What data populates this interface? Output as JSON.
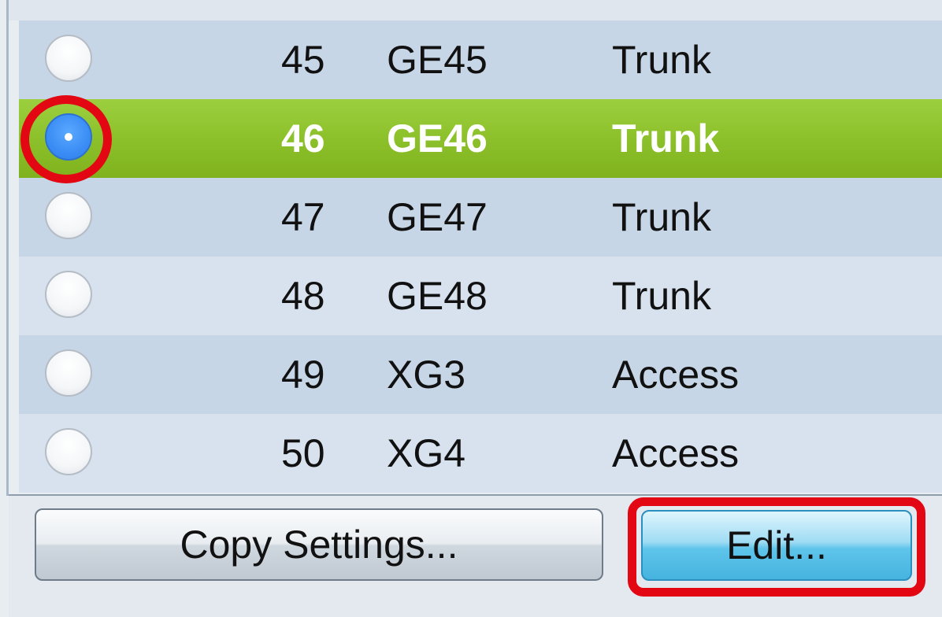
{
  "ports": [
    {
      "number": "45",
      "port": "GE45",
      "mode": "Trunk",
      "selected": false
    },
    {
      "number": "46",
      "port": "GE46",
      "mode": "Trunk",
      "selected": true
    },
    {
      "number": "47",
      "port": "GE47",
      "mode": "Trunk",
      "selected": false
    },
    {
      "number": "48",
      "port": "GE48",
      "mode": "Trunk",
      "selected": false
    },
    {
      "number": "49",
      "port": "XG3",
      "mode": "Access",
      "selected": false
    },
    {
      "number": "50",
      "port": "XG4",
      "mode": "Access",
      "selected": false
    }
  ],
  "buttons": {
    "copy_settings": "Copy Settings...",
    "edit": "Edit..."
  },
  "colors": {
    "selected_row": "#8dc12b",
    "highlight": "#e30613",
    "edit_button": "#5ec4ea",
    "radio_checked": "#3b8df5"
  }
}
